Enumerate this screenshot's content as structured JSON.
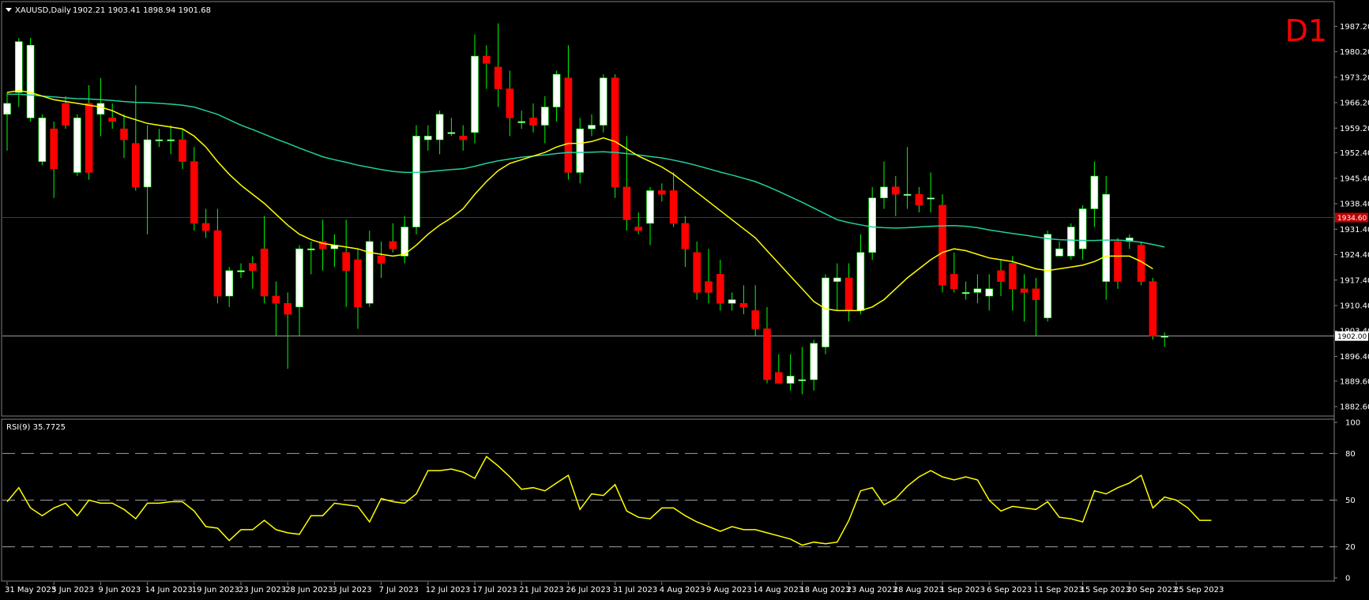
{
  "header": {
    "symbol": "XAUUSD,Daily",
    "ohlc": "1902.21 1903.41 1898.94 1901.68",
    "timeframe_badge": "D1"
  },
  "rsi_label": "RSI(9) 35.7725",
  "colors": {
    "background": "#000000",
    "bull_candle": "#ffffff",
    "bear_candle": "#ff0000",
    "wick": "#00ff00",
    "ma_fast": "#ffff00",
    "ma_slow": "#20d0a0",
    "rsi_line": "#ffff00",
    "ref_line": "#c00000",
    "last_price_line": "#a0a0a0",
    "axis_text": "#ffffff",
    "badge": "#ff0000"
  },
  "chart_data": [
    {
      "type": "candlestick",
      "title": "XAUUSD,Daily",
      "ylim": [
        1880.0,
        1994.0
      ],
      "y_ticks": [
        "1987.20",
        "1980.20",
        "1973.20",
        "1966.20",
        "1959.20",
        "1952.40",
        "1945.40",
        "1938.40",
        "1931.40",
        "1924.40",
        "1917.40",
        "1910.40",
        "1903.40",
        "1896.40",
        "1889.60",
        "1882.60"
      ],
      "x_tick_labels": [
        {
          "index": 0,
          "label": "31 May 2023"
        },
        {
          "index": 4,
          "label": "5 Jun 2023"
        },
        {
          "index": 8,
          "label": "9 Jun 2023"
        },
        {
          "index": 12,
          "label": "14 Jun 2023"
        },
        {
          "index": 16,
          "label": "19 Jun 2023"
        },
        {
          "index": 20,
          "label": "23 Jun 2023"
        },
        {
          "index": 24,
          "label": "28 Jun 2023"
        },
        {
          "index": 28,
          "label": "3 Jul 2023"
        },
        {
          "index": 32,
          "label": "7 Jul 2023"
        },
        {
          "index": 36,
          "label": "12 Jul 2023"
        },
        {
          "index": 40,
          "label": "17 Jul 2023"
        },
        {
          "index": 44,
          "label": "21 Jul 2023"
        },
        {
          "index": 48,
          "label": "26 Jul 2023"
        },
        {
          "index": 52,
          "label": "31 Jul 2023"
        },
        {
          "index": 56,
          "label": "4 Aug 2023"
        },
        {
          "index": 60,
          "label": "9 Aug 2023"
        },
        {
          "index": 64,
          "label": "14 Aug 2023"
        },
        {
          "index": 68,
          "label": "18 Aug 2023"
        },
        {
          "index": 72,
          "label": "23 Aug 2023"
        },
        {
          "index": 76,
          "label": "28 Aug 2023"
        },
        {
          "index": 80,
          "label": "1 Sep 2023"
        },
        {
          "index": 84,
          "label": "6 Sep 2023"
        },
        {
          "index": 88,
          "label": "11 Sep 2023"
        },
        {
          "index": 92,
          "label": "15 Sep 2023"
        },
        {
          "index": 96,
          "label": "20 Sep 2023"
        },
        {
          "index": 100,
          "label": "25 Sep 2023"
        }
      ],
      "candles": [
        [
          1963,
          1966,
          1953,
          1969
        ],
        [
          1969,
          1983,
          1965,
          1984
        ],
        [
          1962,
          1982,
          1961,
          1984
        ],
        [
          1950,
          1962,
          1949,
          1963
        ],
        [
          1959,
          1948,
          1940,
          1961
        ],
        [
          1966,
          1960,
          1959,
          1968
        ],
        [
          1947,
          1962,
          1946,
          1963
        ],
        [
          1966,
          1947,
          1945,
          1971
        ],
        [
          1963,
          1966,
          1957,
          1973
        ],
        [
          1962,
          1961,
          1959,
          1966
        ],
        [
          1959,
          1956,
          1951,
          1963
        ],
        [
          1955,
          1943,
          1942,
          1971
        ],
        [
          1943,
          1956,
          1930,
          1960
        ],
        [
          1956,
          1956,
          1954,
          1959
        ],
        [
          1956,
          1956,
          1952,
          1960
        ],
        [
          1956,
          1950,
          1948,
          1959
        ],
        [
          1950,
          1933,
          1931,
          1954
        ],
        [
          1933,
          1931,
          1929,
          1937
        ],
        [
          1931,
          1913,
          1911,
          1937
        ],
        [
          1913,
          1920,
          1910,
          1921
        ],
        [
          1920,
          1920,
          1918,
          1922
        ],
        [
          1922,
          1920,
          1915,
          1924
        ],
        [
          1926,
          1913,
          1911,
          1935
        ],
        [
          1913,
          1911,
          1902,
          1917
        ],
        [
          1911,
          1908,
          1893,
          1914
        ],
        [
          1910,
          1926,
          1902,
          1927
        ],
        [
          1926,
          1926,
          1919,
          1928
        ],
        [
          1928,
          1926,
          1920,
          1934
        ],
        [
          1926,
          1927,
          1921,
          1930
        ],
        [
          1925,
          1920,
          1910,
          1934
        ],
        [
          1923,
          1910,
          1904,
          1926
        ],
        [
          1911,
          1928,
          1910,
          1931
        ],
        [
          1924,
          1922,
          1918,
          1928
        ],
        [
          1928,
          1926,
          1925,
          1933
        ],
        [
          1924,
          1932,
          1922,
          1935
        ],
        [
          1932,
          1957,
          1930,
          1960
        ],
        [
          1956,
          1957,
          1953,
          1960
        ],
        [
          1956,
          1963,
          1952,
          1964
        ],
        [
          1958,
          1958,
          1957,
          1962
        ],
        [
          1957,
          1956,
          1953,
          1960
        ],
        [
          1958,
          1979,
          1955,
          1985
        ],
        [
          1979,
          1977,
          1970,
          1982
        ],
        [
          1976,
          1970,
          1965,
          1988
        ],
        [
          1970,
          1962,
          1957,
          1975
        ],
        [
          1961,
          1961,
          1959,
          1964
        ],
        [
          1962,
          1960,
          1958,
          1966
        ],
        [
          1960,
          1965,
          1955,
          1968
        ],
        [
          1965,
          1974,
          1961,
          1975
        ],
        [
          1973,
          1947,
          1945,
          1982
        ],
        [
          1947,
          1959,
          1944,
          1962
        ],
        [
          1959,
          1960,
          1957,
          1963
        ],
        [
          1960,
          1973,
          1958,
          1974
        ],
        [
          1973,
          1943,
          1940,
          1974
        ],
        [
          1943,
          1934,
          1931,
          1957
        ],
        [
          1932,
          1931,
          1930,
          1936
        ],
        [
          1933,
          1942,
          1927,
          1943
        ],
        [
          1942,
          1941,
          1939,
          1944
        ],
        [
          1942,
          1933,
          1932,
          1947
        ],
        [
          1933,
          1926,
          1921,
          1935
        ],
        [
          1925,
          1914,
          1912,
          1928
        ],
        [
          1917,
          1914,
          1911,
          1926
        ],
        [
          1919,
          1911,
          1909,
          1923
        ],
        [
          1911,
          1912,
          1909,
          1914
        ],
        [
          1911,
          1910,
          1908,
          1916
        ],
        [
          1909,
          1904,
          1902,
          1916
        ],
        [
          1904,
          1890,
          1889,
          1910
        ],
        [
          1892,
          1889,
          1889,
          1897
        ],
        [
          1889,
          1891,
          1887,
          1897
        ],
        [
          1890,
          1890,
          1886,
          1899
        ],
        [
          1890,
          1900,
          1887,
          1901
        ],
        [
          1899,
          1918,
          1897,
          1919
        ],
        [
          1917,
          1918,
          1909,
          1922
        ],
        [
          1918,
          1909,
          1906,
          1922
        ],
        [
          1909,
          1925,
          1908,
          1930
        ],
        [
          1925,
          1940,
          1923,
          1943
        ],
        [
          1940,
          1943,
          1937,
          1950
        ],
        [
          1943,
          1941,
          1935,
          1946
        ],
        [
          1941,
          1941,
          1937,
          1954
        ],
        [
          1941,
          1938,
          1936,
          1943
        ],
        [
          1940,
          1940,
          1936,
          1947
        ],
        [
          1938,
          1916,
          1914,
          1941
        ],
        [
          1919,
          1915,
          1914,
          1925
        ],
        [
          1914,
          1914,
          1912,
          1917
        ],
        [
          1914,
          1915,
          1911,
          1919
        ],
        [
          1913,
          1915,
          1909,
          1919
        ],
        [
          1920,
          1917,
          1913,
          1923
        ],
        [
          1922,
          1915,
          1909,
          1924
        ],
        [
          1915,
          1914,
          1906,
          1919
        ],
        [
          1915,
          1912,
          1902,
          1918
        ],
        [
          1907,
          1930,
          1906,
          1931
        ],
        [
          1924,
          1926,
          1924,
          1928
        ],
        [
          1924,
          1932,
          1923,
          1933
        ],
        [
          1926,
          1937,
          1923,
          1938
        ],
        [
          1937,
          1946,
          1932,
          1950
        ],
        [
          1917,
          1941,
          1912,
          1946
        ],
        [
          1928,
          1917,
          1915,
          1929
        ],
        [
          1928,
          1929,
          1926,
          1930
        ],
        [
          1927,
          1917,
          1916,
          1928
        ],
        [
          1917,
          1902,
          1901,
          1918
        ],
        [
          1902,
          1902,
          1899,
          1903
        ]
      ],
      "ma_fast": [
        1969,
        1969.5,
        1969,
        1968,
        1967,
        1966.5,
        1966,
        1965.5,
        1965,
        1964,
        1962.5,
        1961.5,
        1960.5,
        1960,
        1959.5,
        1959,
        1957,
        1954,
        1950,
        1946.5,
        1943.5,
        1941,
        1938.5,
        1935.5,
        1932.5,
        1930,
        1928.5,
        1927.5,
        1927,
        1926.5,
        1926,
        1925,
        1924.5,
        1924,
        1924.5,
        1927,
        1930,
        1932.5,
        1934.5,
        1937,
        1941,
        1944.5,
        1947.5,
        1949.5,
        1950.5,
        1951.5,
        1952.5,
        1954,
        1955,
        1955,
        1955.5,
        1956.5,
        1955.5,
        1953.5,
        1951.5,
        1950,
        1948.5,
        1946.5,
        1944,
        1941.5,
        1939,
        1936.5,
        1934,
        1931.5,
        1929,
        1925.5,
        1922,
        1918.5,
        1915,
        1911.5,
        1909.5,
        1909,
        1909,
        1909,
        1910,
        1912,
        1915,
        1918,
        1920.5,
        1923,
        1925,
        1926,
        1925.5,
        1924.5,
        1923.5,
        1923,
        1922.5,
        1921.5,
        1920.5,
        1920,
        1920.5,
        1921,
        1921.5,
        1922.5,
        1924,
        1924,
        1924,
        1922.5,
        1920.5
      ],
      "ma_slow": [
        1968.5,
        1968.5,
        1968.3,
        1968,
        1967.8,
        1967.5,
        1967.3,
        1967.2,
        1967,
        1966.8,
        1966.5,
        1966.3,
        1966.2,
        1966,
        1965.8,
        1965.5,
        1965,
        1964,
        1963,
        1961.5,
        1960,
        1958.8,
        1957.5,
        1956.2,
        1955,
        1953.7,
        1952.5,
        1951.3,
        1950.5,
        1949.8,
        1949,
        1948.4,
        1947.8,
        1947.3,
        1947,
        1947,
        1947.2,
        1947.5,
        1947.8,
        1948,
        1948.7,
        1949.5,
        1950.2,
        1950.7,
        1951.2,
        1951.5,
        1951.8,
        1952.2,
        1952.5,
        1952.5,
        1952.6,
        1952.7,
        1952.5,
        1952.2,
        1951.8,
        1951.4,
        1951,
        1950.4,
        1949.7,
        1948.9,
        1948,
        1947.1,
        1946.3,
        1945.4,
        1944.5,
        1943.2,
        1941.8,
        1940.3,
        1938.8,
        1937.2,
        1935.6,
        1934,
        1933.2,
        1932.6,
        1932,
        1931.8,
        1931.7,
        1931.8,
        1932,
        1932.2,
        1932.3,
        1932.4,
        1932.2,
        1931.8,
        1931.2,
        1930.7,
        1930.2,
        1929.8,
        1929.3,
        1928.8,
        1928.5,
        1928.4,
        1928.3,
        1928.3,
        1928.4,
        1928.4,
        1928.2,
        1927.8,
        1927.2,
        1926.5
      ]
    },
    {
      "type": "line",
      "title": "RSI(9) 35.7725",
      "ylim": [
        0,
        100
      ],
      "y_ticks": [
        "100",
        "80",
        "50",
        "20",
        "0"
      ],
      "reference_levels": [
        80,
        50,
        20
      ],
      "values": [
        49,
        58,
        45,
        40,
        45,
        48,
        40,
        50,
        48,
        48,
        44,
        38,
        48,
        48,
        49,
        49,
        43,
        33,
        32,
        24,
        31,
        31,
        37,
        31,
        29,
        28,
        40,
        40,
        48,
        47,
        46,
        36,
        51,
        49,
        48,
        54,
        69,
        69,
        70,
        68,
        64,
        78,
        72,
        65,
        57,
        58,
        56,
        61,
        66,
        44,
        54,
        53,
        60,
        43,
        39,
        38,
        45,
        45,
        40,
        36,
        33,
        30,
        33,
        31,
        31,
        29,
        27,
        25,
        21,
        23,
        22,
        23,
        37,
        56,
        58,
        47,
        51,
        59,
        65,
        69,
        65,
        63,
        65,
        63,
        50,
        43,
        46,
        45,
        44,
        49,
        39,
        38,
        36,
        56,
        54,
        58,
        61,
        66,
        45,
        52,
        50,
        45,
        37,
        37
      ]
    }
  ]
}
